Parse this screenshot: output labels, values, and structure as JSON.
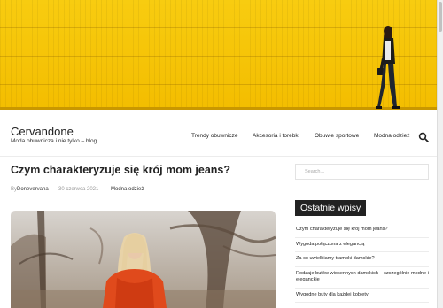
{
  "site": {
    "title": "Cervandone",
    "description": "Moda obuwnicza i nie tylko – blog"
  },
  "nav": {
    "items": [
      {
        "label": "Trendy obuwnicze"
      },
      {
        "label": "Akcesoria i torebki"
      },
      {
        "label": "Obuwie sportowe"
      },
      {
        "label": "Modna odzież"
      }
    ],
    "search_icon": "search-icon"
  },
  "post": {
    "title": "Czym charakteryzuje się krój mom jeans?",
    "author_prefix": "By",
    "author": "Donevervana",
    "date": "30 czerwca 2021",
    "category": "Modna odzież"
  },
  "sidebar": {
    "search_placeholder": "Search...",
    "widget_title": "Ostatnie wpisy",
    "recent_posts": [
      {
        "label": "Czym charakteryzuje się krój mom jeans?"
      },
      {
        "label": "Wygoda połączona z elegancją"
      },
      {
        "label": "Za co uwielbiamy trampki damskie?"
      },
      {
        "label": "Rodzaje butów wiosennych damskich – szczególnie modne i eleganckie"
      },
      {
        "label": "Wygodne buty dla każdej kobiety"
      }
    ]
  },
  "colors": {
    "hero_yellow": "#f6c300",
    "widget_title_bg": "#222222",
    "text": "#222222",
    "meta_text": "#999999"
  }
}
